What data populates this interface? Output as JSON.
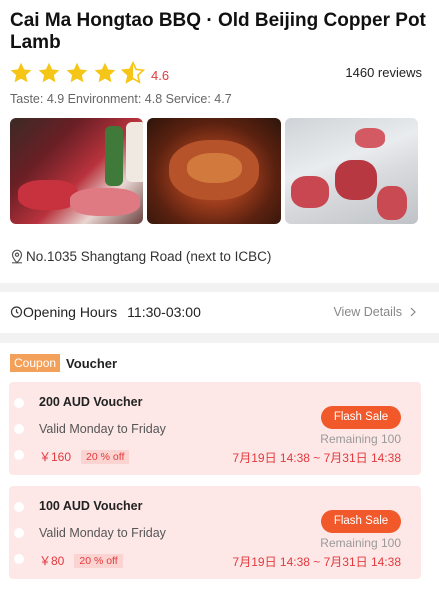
{
  "restaurant": {
    "title": "Cai Ma Hongtao BBQ · Old Beijing Copper Pot Lamb",
    "rating": "4.6",
    "stars_filled": 4.5,
    "stars_total": 5,
    "reviews": "1460 reviews",
    "scores": "Taste: 4.9 Environment: 4.8 Service: 4.7",
    "address": "No.1035 Shangtang Road (next to ICBC)"
  },
  "hours": {
    "label": "Opening Hours",
    "time": "11:30-03:00",
    "view_details": "View Details"
  },
  "coupons": {
    "tag": "Coupon",
    "section_title": "Voucher",
    "items": [
      {
        "name": "200 AUD Voucher",
        "valid": "Valid Monday to Friday",
        "price": "￥160",
        "discount": "20 % off",
        "button": "Flash Sale",
        "remaining": "Remaining 100",
        "date_range": "7月19日 14:38 ~ 7月31日 14:38"
      },
      {
        "name": "100 AUD Voucher",
        "valid": "Valid Monday to Friday",
        "price": "￥80",
        "discount": "20 % off",
        "button": "Flash Sale",
        "remaining": "Remaining 100",
        "date_range": "7月19日 14:38 ~ 7月31日 14:38"
      }
    ]
  },
  "colors": {
    "accent_red": "#e4393c",
    "star_yellow": "#f5c518",
    "flash_orange": "#f1582a",
    "coupon_tag": "#f3a15a"
  },
  "icons": [
    "star-icon",
    "location-pin-icon",
    "clock-icon",
    "chevron-right-icon"
  ]
}
